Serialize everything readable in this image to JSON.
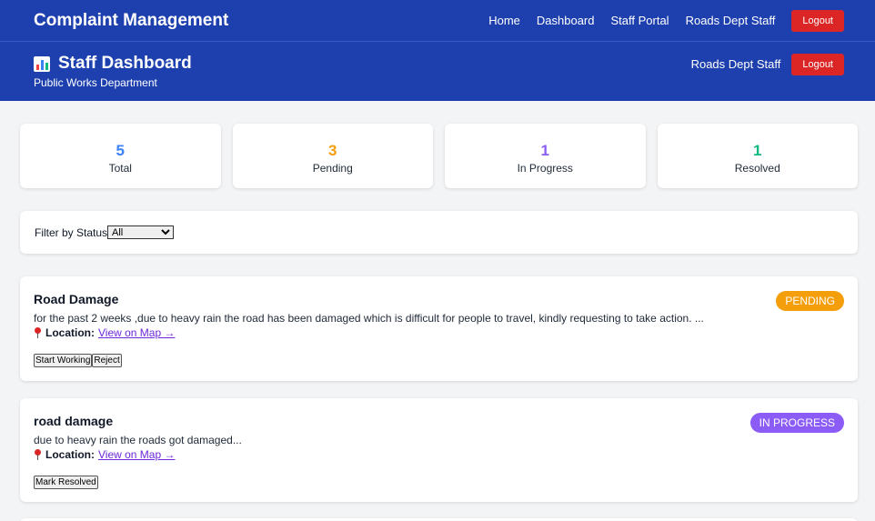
{
  "topnav": {
    "brand": "Complaint Management",
    "links": [
      "Home",
      "Dashboard",
      "Staff Portal",
      "Roads Dept Staff"
    ],
    "logout_label": "Logout"
  },
  "dashboard_header": {
    "title": "Staff Dashboard",
    "subtitle": "Public Works Department",
    "user": "Roads Dept Staff",
    "logout_label": "Logout",
    "icon": "bar-chart-icon"
  },
  "stats": [
    {
      "value": "5",
      "label": "Total",
      "color": "#3b82f6"
    },
    {
      "value": "3",
      "label": "Pending",
      "color": "#f59e0b"
    },
    {
      "value": "1",
      "label": "In Progress",
      "color": "#8b5cf6"
    },
    {
      "value": "1",
      "label": "Resolved",
      "color": "#10b981"
    }
  ],
  "filter": {
    "label": "Filter by Status",
    "selected": "All"
  },
  "complaints": [
    {
      "title": "Road Damage",
      "description": "for the past 2 weeks ,due to heavy rain the road has been damaged which is difficult for people to travel, kindly requesting to take action. ...",
      "location_label": "Location:",
      "map_link": "View on Map →",
      "status": "PENDING",
      "status_color": "#f59e0b",
      "actions": [
        "Start Working",
        "Reject"
      ]
    },
    {
      "title": "road damage",
      "description": "due to heavy rain the roads got damaged...",
      "location_label": "Location:",
      "map_link": "View on Map →",
      "status": "IN PROGRESS",
      "status_color": "#8b5cf6",
      "actions": [
        "Mark Resolved"
      ]
    }
  ],
  "colors": {
    "nav_bg": "#1e40af",
    "logout_bg": "#dc2626"
  }
}
